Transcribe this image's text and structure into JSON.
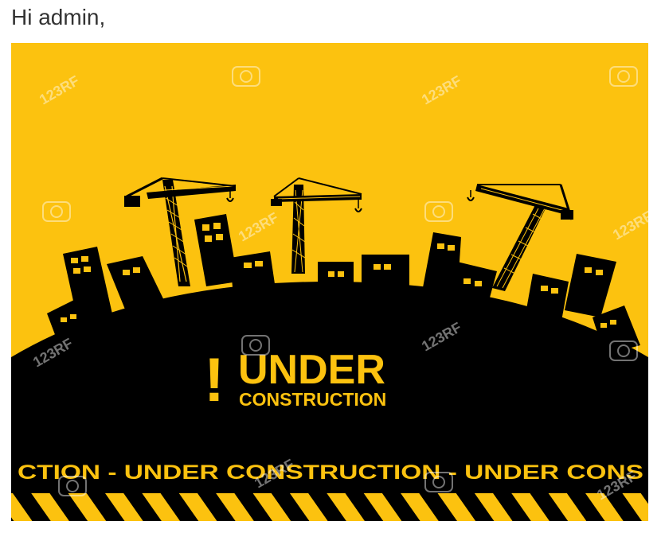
{
  "page": {
    "greeting": "Hi admin,"
  },
  "banner": {
    "headline_mark": "!",
    "headline_main": "UNDER",
    "headline_sub": "CONSTRUCTION",
    "ticker_text": "CTION - UNDER  CONSTRUCTION - UNDER  CONS",
    "watermark_text": "123RF",
    "colors": {
      "background_yellow": "#fcc20f",
      "silhouette_black": "#000000"
    }
  }
}
